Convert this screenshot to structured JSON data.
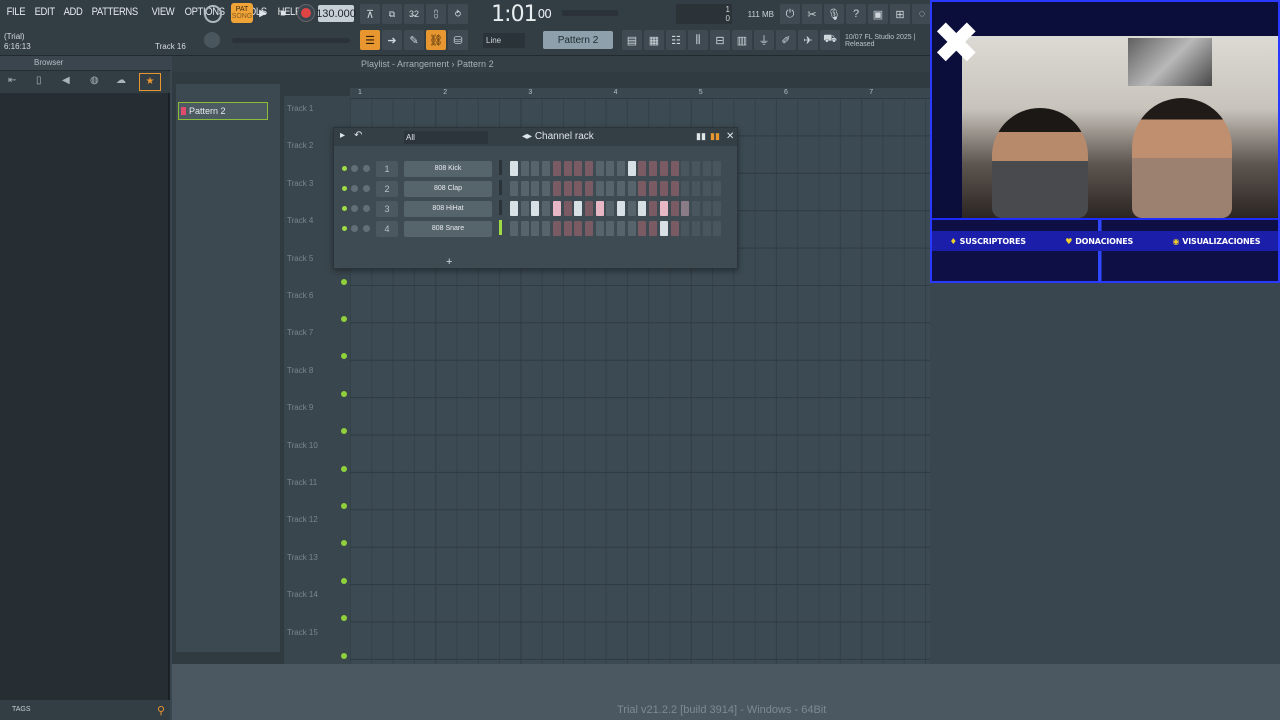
{
  "menu": [
    "FILE",
    "EDIT",
    "ADD",
    "PATTERNS",
    "VIEW",
    "OPTIONS",
    "TOOLS",
    "HELP"
  ],
  "hints": {
    "line1": "(Trial)",
    "line2": "6:16:13",
    "track": "Track 16"
  },
  "transport": {
    "pat_label": "PAT",
    "song_label": "SONG",
    "tempo": "130.000",
    "time_main": "1:01",
    "time_sub": "00",
    "snap": "Line",
    "pattern": "Pattern 2",
    "memory": "111 MB",
    "cpu": "1",
    "poly": "0"
  },
  "news": {
    "date": "10/07",
    "line1": "FL Studio 2025 |",
    "line2": "Released"
  },
  "browser": {
    "title": "Browser",
    "tags": "TAGS"
  },
  "playlist": {
    "title": "Playlist - Arrangement",
    "pattern_title": "Pattern 2",
    "patterns": [
      "Pattern 2"
    ],
    "tracks": [
      "Track 1",
      "Track 2",
      "Track 3",
      "Track 4",
      "Track 5",
      "Track 6",
      "Track 7",
      "Track 8",
      "Track 9",
      "Track 10",
      "Track 11",
      "Track 12",
      "Track 13",
      "Track 14",
      "Track 15"
    ],
    "bars": [
      "1",
      "2",
      "3",
      "4",
      "5",
      "6",
      "7"
    ]
  },
  "channel_rack": {
    "title": "Channel rack",
    "filter": "All",
    "channels": [
      {
        "num": "1",
        "name": "808 Kick",
        "steps": [
          1,
          0,
          0,
          0,
          0,
          0,
          0,
          0,
          0,
          0,
          0,
          1,
          0,
          0,
          0,
          0,
          0,
          0,
          0,
          0
        ]
      },
      {
        "num": "2",
        "name": "808 Clap",
        "steps": [
          0,
          0,
          0,
          0,
          0,
          0,
          0,
          0,
          0,
          0,
          0,
          0,
          0,
          0,
          0,
          0,
          0,
          0,
          0,
          0
        ]
      },
      {
        "num": "3",
        "name": "808 HiHat",
        "steps": [
          1,
          0,
          1,
          0,
          2,
          0,
          1,
          0,
          2,
          0,
          1,
          0,
          1,
          0,
          2,
          0,
          2,
          0,
          0,
          0
        ]
      },
      {
        "num": "4",
        "name": "808 Snare",
        "steps": [
          0,
          0,
          0,
          0,
          0,
          0,
          0,
          0,
          0,
          0,
          0,
          0,
          0,
          0,
          1,
          0,
          0,
          0,
          0,
          0
        ]
      }
    ]
  },
  "footer": {
    "version": "Trial v21.2.2 [build 3914] - Windows - 64Bit"
  },
  "webcam": {
    "banner": [
      {
        "icon": "bell-icon",
        "label": "SUSCRIPTORES"
      },
      {
        "icon": "heart-icon",
        "label": "DONACIONES"
      },
      {
        "icon": "eye-icon",
        "label": "VISUALIZACIONES"
      }
    ]
  }
}
